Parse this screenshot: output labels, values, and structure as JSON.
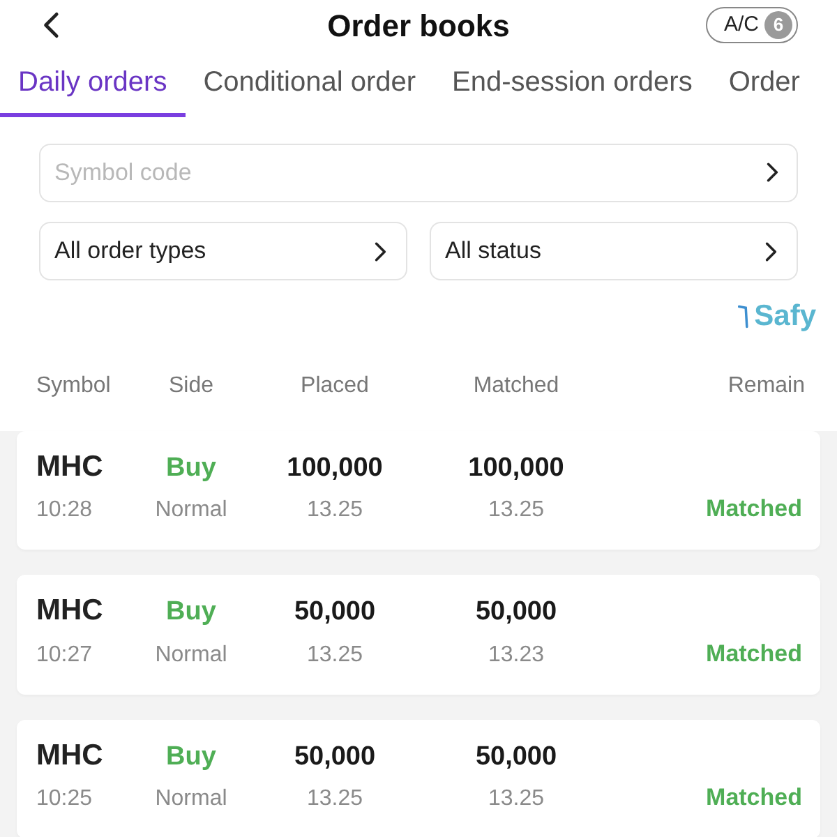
{
  "header": {
    "title": "Order books",
    "account_button": {
      "label": "A/C",
      "badge": "6"
    }
  },
  "tabs": [
    {
      "label": "Daily orders",
      "selected": true
    },
    {
      "label": "Conditional order",
      "selected": false
    },
    {
      "label": "End-session orders",
      "selected": false
    },
    {
      "label": "Order",
      "selected": false
    }
  ],
  "filters": {
    "symbol": {
      "placeholder": "Symbol code"
    },
    "order_type": {
      "value": "All order types"
    },
    "status": {
      "value": "All status"
    }
  },
  "brand": {
    "name": "Safy"
  },
  "table": {
    "columns": [
      "Symbol",
      "Side",
      "Placed",
      "Matched",
      "Remain"
    ],
    "rows": [
      {
        "symbol": "MHC",
        "time": "10:28",
        "side": {
          "label": "Buy",
          "kind": "buy"
        },
        "order_type": "Normal",
        "placed_qty": "100,000",
        "placed_price": "13.25",
        "matched_qty": "100,000",
        "matched_price": "13.25",
        "status": {
          "label": "Matched",
          "kind": "matched"
        }
      },
      {
        "symbol": "MHC",
        "time": "10:27",
        "side": {
          "label": "Buy",
          "kind": "buy"
        },
        "order_type": "Normal",
        "placed_qty": "50,000",
        "placed_price": "13.25",
        "matched_qty": "50,000",
        "matched_price": "13.23",
        "status": {
          "label": "Matched",
          "kind": "matched"
        }
      },
      {
        "symbol": "MHC",
        "time": "10:25",
        "side": {
          "label": "Buy",
          "kind": "buy"
        },
        "order_type": "Normal",
        "placed_qty": "50,000",
        "placed_price": "13.25",
        "matched_qty": "50,000",
        "matched_price": "13.25",
        "status": {
          "label": "Matched",
          "kind": "matched"
        }
      }
    ]
  }
}
